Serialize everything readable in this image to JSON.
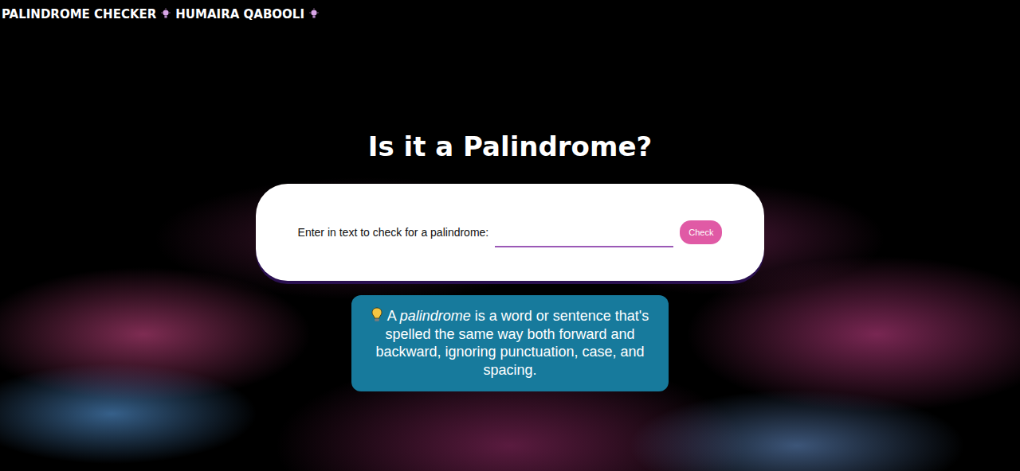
{
  "header": {
    "title": "PALINDROME CHECKER",
    "author": "HUMAIRA QABOOLI"
  },
  "heading": "Is it a Palindrome?",
  "form": {
    "label": "Enter in text to check for a palindrome:",
    "button": "Check"
  },
  "info": {
    "lead": "A ",
    "term": "palindrome",
    "text": " is a word or sentence that's spelled the same way both forward and backward, ignoring punctuation, case, and spacing."
  }
}
